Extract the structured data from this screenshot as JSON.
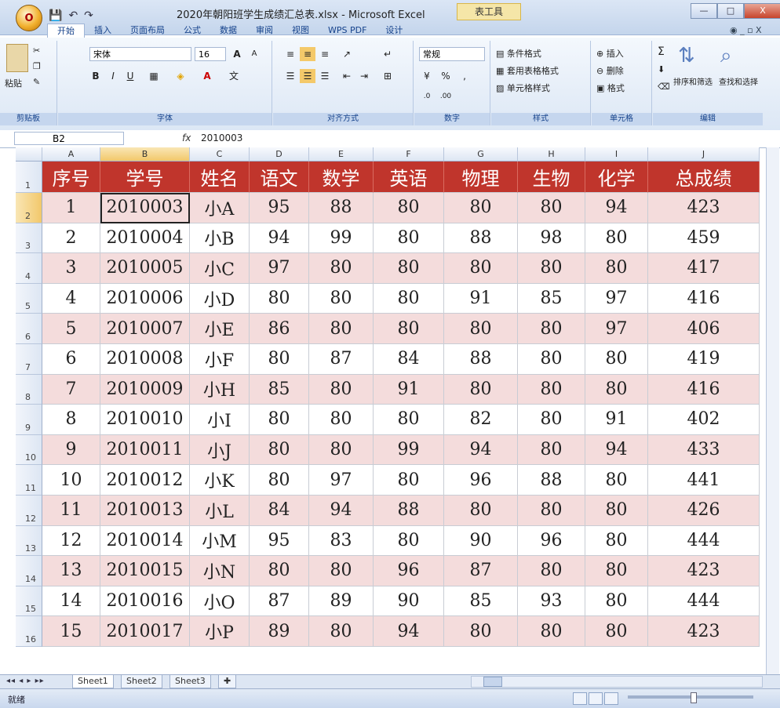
{
  "window": {
    "title": "2020年朝阳班学生成绩汇总表.xlsx - Microsoft Excel",
    "context_tool": "表工具",
    "min_label": "—",
    "max_label": "□",
    "close_label": "X"
  },
  "office_button": {
    "label": "O"
  },
  "qat": {
    "save": "💾",
    "undo": "↶",
    "redo": "↷"
  },
  "ribbon": {
    "tabs": [
      "开始",
      "插入",
      "页面布局",
      "公式",
      "数据",
      "审阅",
      "视图",
      "WPS PDF",
      "设计"
    ],
    "active_tab": 0,
    "right_controls": "◉ _ ▫ X",
    "clipboard": {
      "label": "剪贴板",
      "paste": "粘贴"
    },
    "font": {
      "label": "字体",
      "font_name": "宋体",
      "font_size": "16",
      "bold": "B",
      "italic": "I",
      "underline": "U",
      "grow": "A",
      "shrink": "A"
    },
    "alignment": {
      "label": "对齐方式"
    },
    "number": {
      "label": "数字",
      "format": "常规",
      "percent": "%"
    },
    "styles": {
      "label": "样式",
      "conditional": "条件格式",
      "table_format": "套用表格格式",
      "cell_styles": "单元格样式"
    },
    "cells": {
      "label": "单元格",
      "insert": "插入",
      "delete": "删除",
      "format": "格式"
    },
    "editing": {
      "label": "编辑",
      "sort": "排序和筛选",
      "find": "查找和选择",
      "sigma": "Σ"
    }
  },
  "formula_bar": {
    "name_box": "B2",
    "fx": "fx",
    "content": "2010003"
  },
  "grid": {
    "columns": [
      "A",
      "B",
      "C",
      "D",
      "E",
      "F",
      "G",
      "H",
      "I",
      "J"
    ],
    "selected_column": 1,
    "selected_row": 2,
    "header_row_number": "1",
    "headers": [
      "序号",
      "学号",
      "姓名",
      "语文",
      "数学",
      "英语",
      "物理",
      "生物",
      "化学",
      "总成绩"
    ],
    "rows": [
      [
        "2",
        "1",
        "2010003",
        "小A",
        "95",
        "88",
        "80",
        "80",
        "80",
        "94",
        "423"
      ],
      [
        "3",
        "2",
        "2010004",
        "小B",
        "94",
        "99",
        "80",
        "88",
        "98",
        "80",
        "459"
      ],
      [
        "4",
        "3",
        "2010005",
        "小C",
        "97",
        "80",
        "80",
        "80",
        "80",
        "80",
        "417"
      ],
      [
        "5",
        "4",
        "2010006",
        "小D",
        "80",
        "80",
        "80",
        "91",
        "85",
        "97",
        "416"
      ],
      [
        "6",
        "5",
        "2010007",
        "小E",
        "86",
        "80",
        "80",
        "80",
        "80",
        "97",
        "406"
      ],
      [
        "7",
        "6",
        "2010008",
        "小F",
        "80",
        "87",
        "84",
        "88",
        "80",
        "80",
        "419"
      ],
      [
        "8",
        "7",
        "2010009",
        "小H",
        "85",
        "80",
        "91",
        "80",
        "80",
        "80",
        "416"
      ],
      [
        "9",
        "8",
        "2010010",
        "小I",
        "80",
        "80",
        "80",
        "82",
        "80",
        "91",
        "402"
      ],
      [
        "10",
        "9",
        "2010011",
        "小J",
        "80",
        "80",
        "99",
        "94",
        "80",
        "94",
        "433"
      ],
      [
        "11",
        "10",
        "2010012",
        "小K",
        "80",
        "97",
        "80",
        "96",
        "88",
        "80",
        "441"
      ],
      [
        "12",
        "11",
        "2010013",
        "小L",
        "84",
        "94",
        "88",
        "80",
        "80",
        "80",
        "426"
      ],
      [
        "13",
        "12",
        "2010014",
        "小M",
        "95",
        "83",
        "80",
        "90",
        "96",
        "80",
        "444"
      ],
      [
        "14",
        "13",
        "2010015",
        "小N",
        "80",
        "80",
        "96",
        "87",
        "80",
        "80",
        "423"
      ],
      [
        "15",
        "14",
        "2010016",
        "小O",
        "87",
        "89",
        "90",
        "85",
        "93",
        "80",
        "444"
      ],
      [
        "16",
        "15",
        "2010017",
        "小P",
        "89",
        "80",
        "94",
        "80",
        "80",
        "80",
        "423"
      ]
    ]
  },
  "sheets": {
    "nav": "◂◂ ◂ ▸ ▸▸",
    "tabs": [
      "Sheet1",
      "Sheet2",
      "Sheet3"
    ],
    "active": 0
  },
  "status": {
    "text": "就绪"
  },
  "colors": {
    "header_red": "#c0352c",
    "row_pink": "#f4dcdc"
  }
}
